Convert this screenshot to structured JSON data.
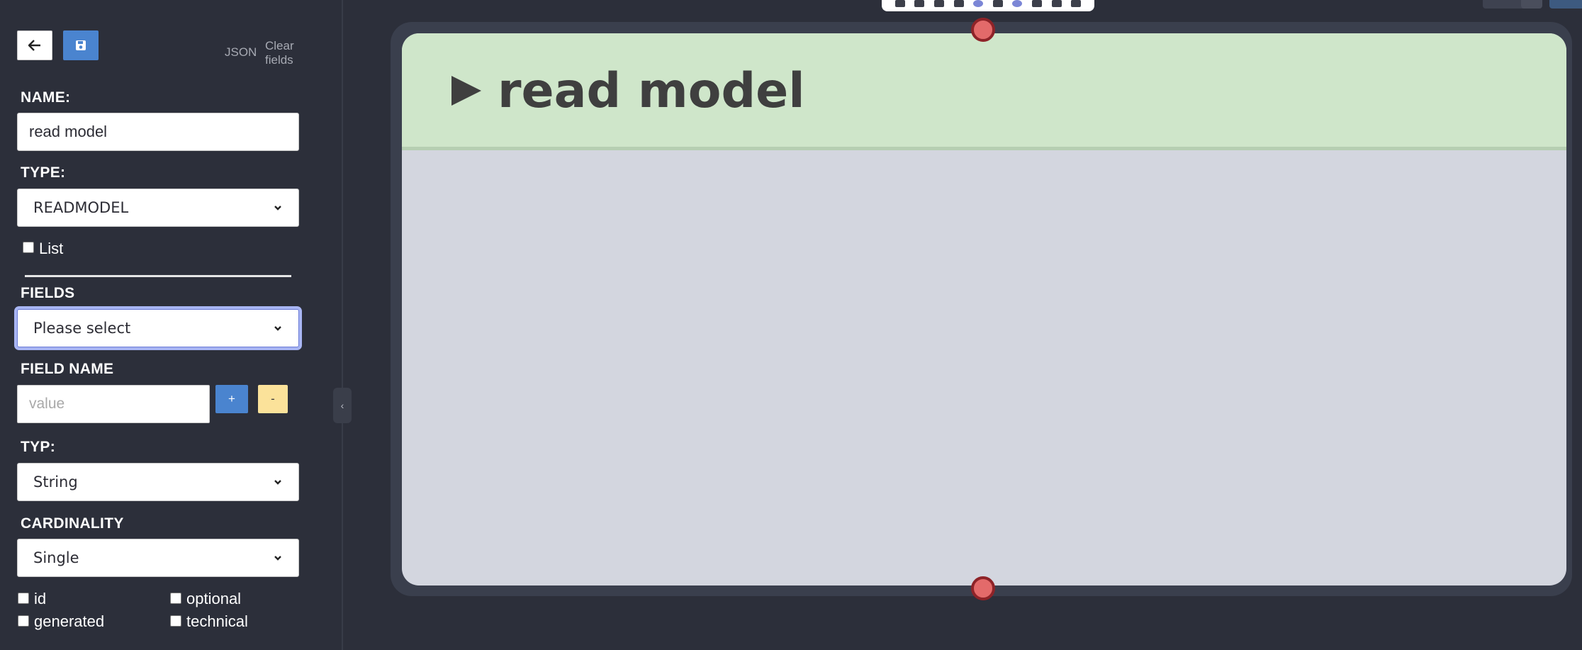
{
  "sidebar": {
    "json_link": "JSON",
    "clear_fields_link": "Clear fields",
    "name_label": "NAME:",
    "name_value": "read model",
    "type_label": "TYPE:",
    "type_value": "READMODEL",
    "list_label": "List",
    "fields_label": "FIELDS",
    "fields_select_value": "Please select",
    "field_name_label": "FIELD NAME",
    "field_name_placeholder": "value",
    "plus_label": "+",
    "minus_label": "-",
    "typ_label": "TYP:",
    "typ_value": "String",
    "cardinality_label": "CARDINALITY",
    "cardinality_value": "Single",
    "checks": {
      "id": "id",
      "optional": "optional",
      "generated": "generated",
      "technical": "technical"
    },
    "collapse_glyph": "‹"
  },
  "canvas": {
    "node_title": "read model",
    "node_header_color": "#cfe6ca",
    "node_body_color": "#d3d6df",
    "port_color": "#e36a6a"
  },
  "icons": {
    "back": "arrow-left-icon",
    "save": "floppy-disk-icon",
    "node_type": "play-icon"
  }
}
